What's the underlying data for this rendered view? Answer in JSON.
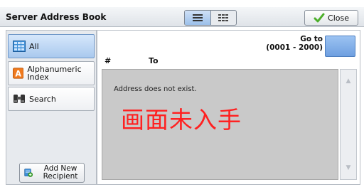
{
  "header": {
    "title": "Server Address Book",
    "close_label": "Close",
    "view_toggle": {
      "active": "list-view"
    }
  },
  "sidebar": {
    "tabs": [
      {
        "label": "All",
        "icon": "address-book-grid-icon",
        "active": true
      },
      {
        "label": "Alphanumeric Index",
        "icon": "letter-a-icon",
        "active": false
      },
      {
        "label": "Search",
        "icon": "binoculars-icon",
        "active": false
      }
    ],
    "add_button_label": "Add New Recipient"
  },
  "main": {
    "goto": {
      "label": "Go to",
      "range": "(0001 - 2000)",
      "value": ""
    },
    "columns": {
      "number": "#",
      "to": "To"
    },
    "empty_message": "Address does not exist.",
    "watermark": "画面未入手"
  },
  "colors": {
    "accent": "#6e9fe0",
    "watermark": "#ff2020",
    "list_bg": "#c9c9c9"
  }
}
